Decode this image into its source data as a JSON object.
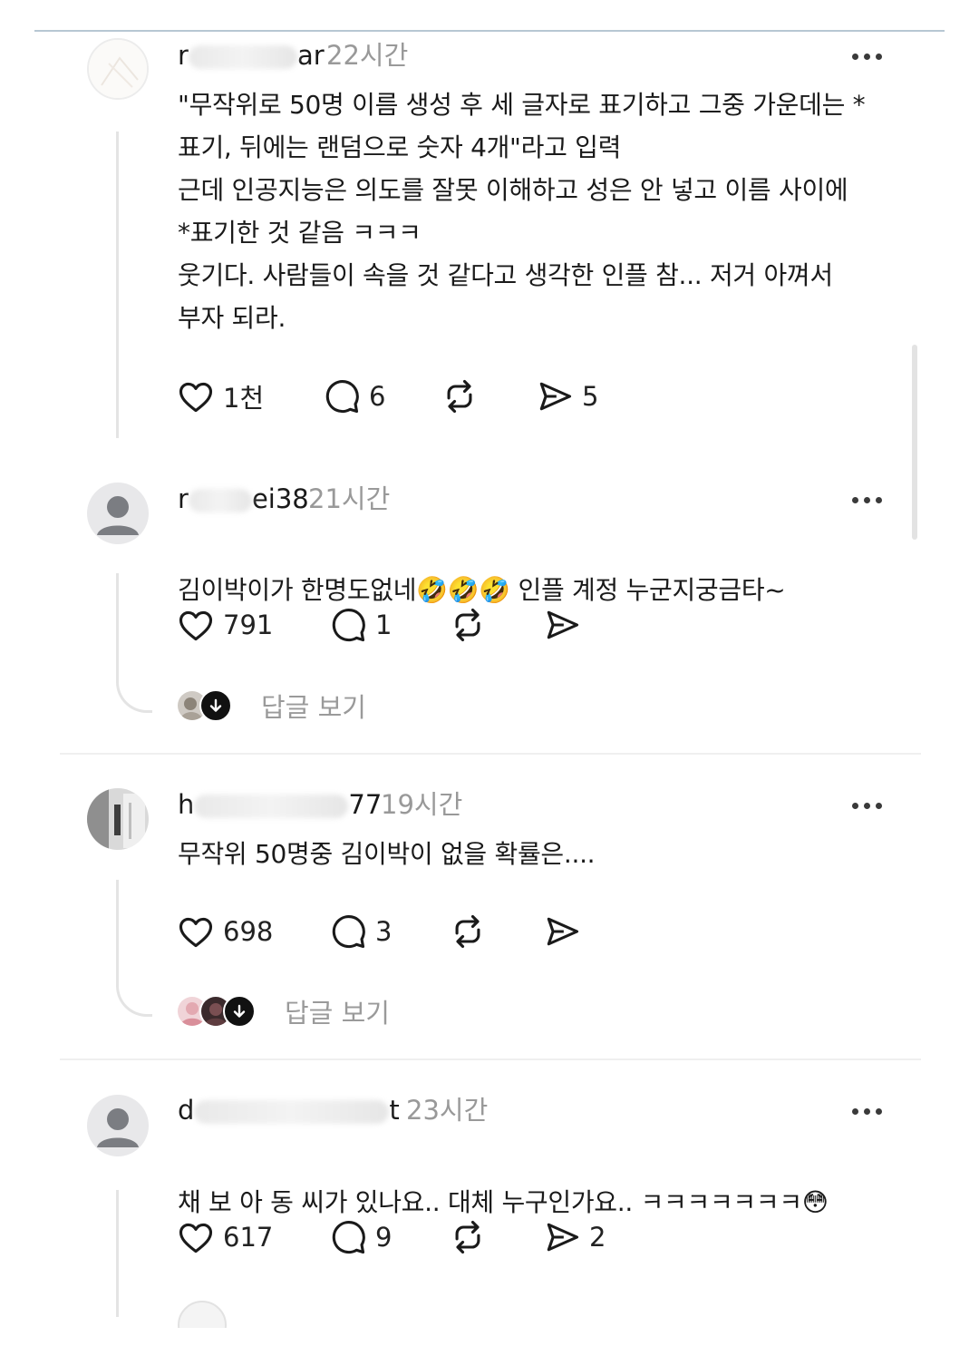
{
  "comments": [
    {
      "user_start": "r",
      "user_end": "ar",
      "time": "22시간",
      "text": "\"무작위로 50명 이름 생성 후 세 글자로 표기하고 그중 가운데는 *\n표기, 뒤에는 랜덤으로 숫자 4개\"라고 입력\n근데 인공지능은 의도를 잘못 이해하고 성은 안 넣고 이름 사이에\n*표기한 것 같음 ㅋㅋㅋ\n웃기다. 사람들이 속을 것 같다고 생각한 인플 참... 저거 아껴서\n부자 되라.",
      "likes": "1천",
      "replies": "6",
      "shares": "5",
      "avatar_icon": "faded-avatar-icon"
    },
    {
      "user_start": "r",
      "user_end": "ei38",
      "time": "21시간",
      "text_before": "김이박이가 한명도없네",
      "emoji": "🤣🤣🤣",
      "text_after": " 인플 계정 누군지궁금타~",
      "likes": "791",
      "replies": "1",
      "shares": "",
      "view_replies": "답글 보기",
      "avatar_icon": "default-avatar-icon"
    },
    {
      "user_start": "h",
      "user_end": "77",
      "time": "19시간",
      "text": "무작위 50명중 김이박이 없을 확률은....",
      "likes": "698",
      "replies": "3",
      "shares": "",
      "view_replies": "답글 보기",
      "avatar_icon": "photo-avatar-icon"
    },
    {
      "user_start": "d",
      "user_end": "t",
      "time": "23시간",
      "text_before": "채 보 아 동 씨가 있나요.. 대체 누구인가요.. ㅋㅋㅋㅋㅋㅋㅋ",
      "emoji": "😳",
      "likes": "617",
      "replies": "9",
      "shares": "2",
      "avatar_icon": "default-avatar-icon"
    }
  ],
  "icons": {
    "like": "heart-icon",
    "reply": "comment-bubble-icon",
    "repost": "repost-icon",
    "share": "send-icon",
    "more": "more-dots-icon",
    "down": "arrow-down-icon"
  },
  "colors": {
    "text": "#1a1a1a",
    "muted": "#999999",
    "thread": "#e4e4e4"
  }
}
